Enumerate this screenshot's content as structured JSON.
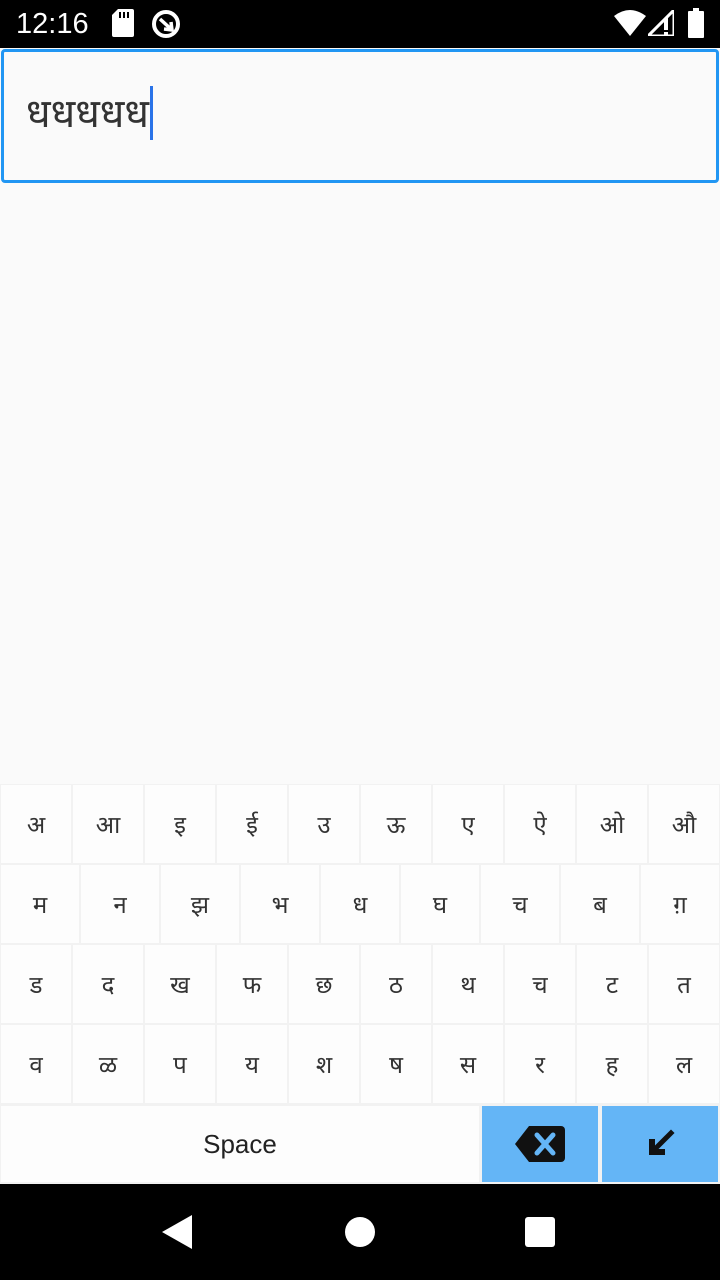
{
  "status_bar": {
    "time": "12:16",
    "icons": [
      "sd-card-icon",
      "data-saver-icon",
      "wifi-icon",
      "signal-icon",
      "battery-icon"
    ]
  },
  "input": {
    "value": "धधधधध"
  },
  "keyboard": {
    "rows": [
      [
        "अ",
        "आ",
        "इ",
        "ई",
        "उ",
        "ऊ",
        "ए",
        "ऐ",
        "ओ",
        "औ"
      ],
      [
        "म",
        "न",
        "झ",
        "भ",
        "ध",
        "घ",
        "च",
        "ब",
        "ग़"
      ],
      [
        "ड",
        "द",
        "ख",
        "फ",
        "छ",
        "ठ",
        "थ",
        "च",
        "ट",
        "त"
      ],
      [
        "व",
        "ळ",
        "प",
        "य",
        "श",
        "ष",
        "स",
        "र",
        "ह",
        "ल"
      ]
    ],
    "space_label": "Space",
    "backspace_icon": "backspace-icon",
    "enter_icon": "enter-arrow-icon",
    "action_key_color": "#64b5f6"
  },
  "nav_bar": {
    "buttons": [
      "back-icon",
      "home-icon",
      "recents-icon"
    ]
  },
  "colors": {
    "accent": "#2196f3",
    "caret": "#2a73e8"
  }
}
